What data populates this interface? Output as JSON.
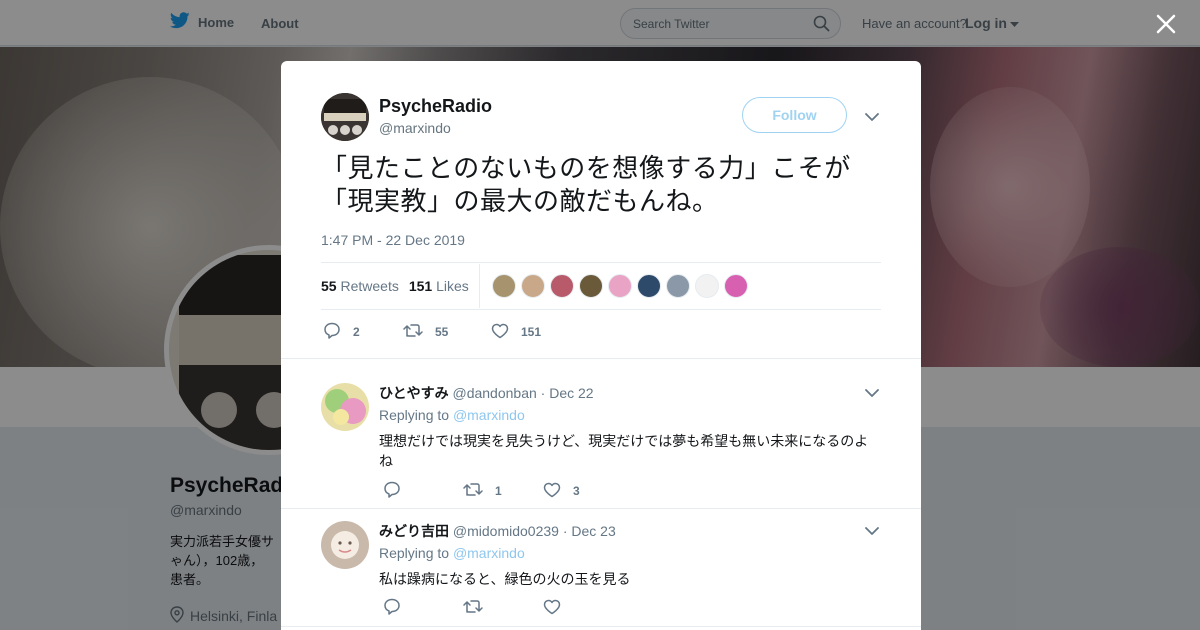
{
  "nav": {
    "home": "Home",
    "about": "About",
    "search_placeholder": "Search Twitter",
    "account_prompt": "Have an account?",
    "login": "Log in"
  },
  "profile": {
    "name": "PsycheRad",
    "handle": "@marxindo",
    "bio": "実力派若手女優サ ゃん），102歳， 患者。",
    "location": "Helsinki, Finla"
  },
  "tweet": {
    "author_name": "PsycheRadio",
    "author_handle": "@marxindo",
    "follow_label": "Follow",
    "text": "「見たことのないものを想像する力」こそが「現実教」の最大の敵だもんね。",
    "timestamp": "1:47 PM - 22 Dec 2019",
    "retweets_count": "55",
    "retweets_label": "Retweets",
    "likes_count": "151",
    "likes_label": "Likes",
    "action_replies": "2",
    "action_retweets": "55",
    "action_likes": "151",
    "liker_colors": [
      "#a7946f",
      "#c9a88a",
      "#b85a6a",
      "#6b5a3a",
      "#e8a3c5",
      "#2e4a6a",
      "#8a98a8",
      "#f2f2f2",
      "#d860b0"
    ]
  },
  "replies": [
    {
      "name": "ひとやすみ",
      "handle": "@dandonban",
      "date": "· Dec 22",
      "replying_prefix": "Replying to",
      "replying_to": "@marxindo",
      "text": "理想だけでは現実を見失うけど、現実だけでは夢も希望も無い未来になるのよね",
      "replies": "",
      "retweets": "1",
      "likes": "3"
    },
    {
      "name": "みどり吉田",
      "handle": "@midomido0239",
      "date": "· Dec 23",
      "replying_prefix": "Replying to",
      "replying_to": "@marxindo",
      "text": "私は躁病になると、緑色の火の玉を見る",
      "replies": "",
      "retweets": "",
      "likes": ""
    }
  ],
  "colors": {
    "brand": "#1da1f2",
    "text_secondary": "#657786",
    "link": "#8ec7ee"
  }
}
